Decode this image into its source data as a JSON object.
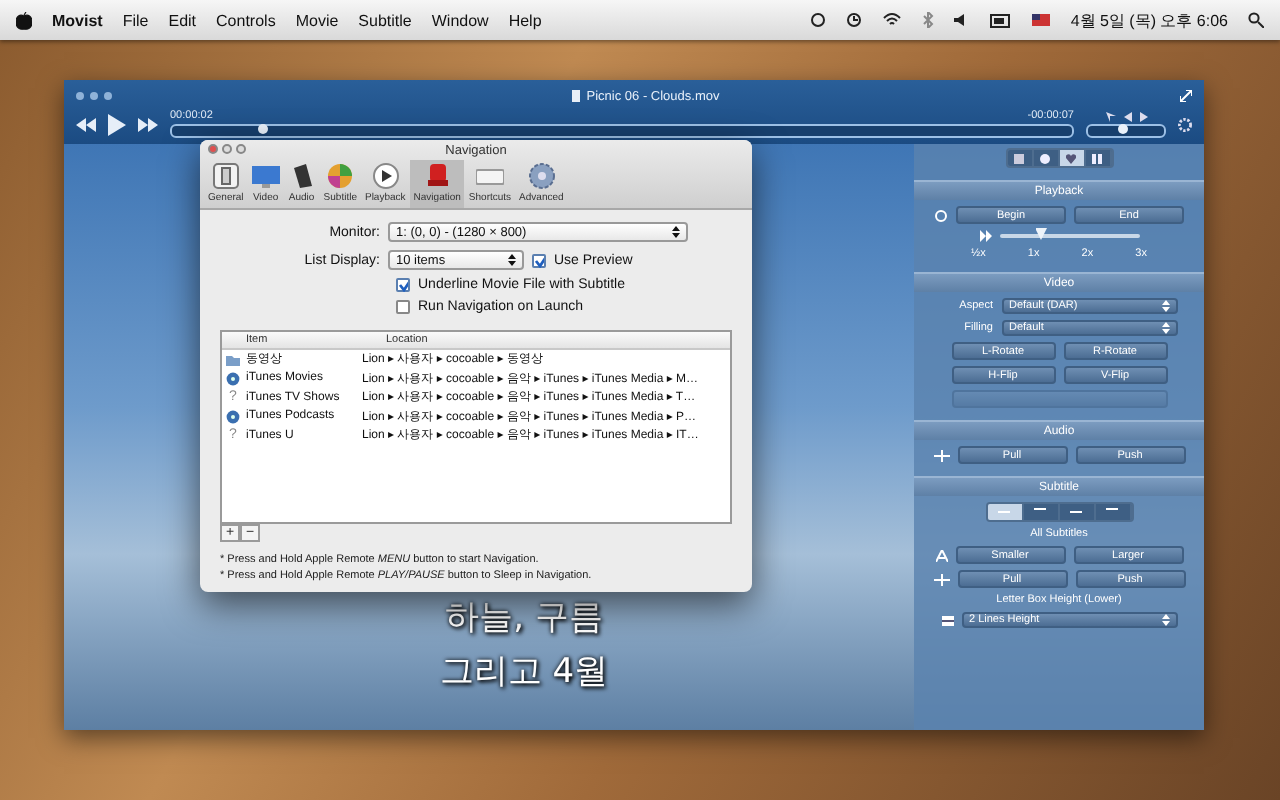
{
  "menu_bar": {
    "app": "Movist",
    "menus": [
      "File",
      "Edit",
      "Controls",
      "Movie",
      "Subtitle",
      "Window",
      "Help"
    ],
    "clock": "4월 5일 (목) 오후 6:06"
  },
  "player": {
    "title": "Picnic 06 - Clouds.mov",
    "elapsed": "00:00:02",
    "remaining": "-00:00:07",
    "position": {
      "level": 0.1
    },
    "volume": {
      "level": 0.45
    },
    "subtitles": [
      "하늘, 구름",
      "그리고 4월"
    ]
  },
  "dialog": {
    "title": "Navigation",
    "toolbar": [
      {
        "label": "General",
        "kind": "general",
        "selected": false
      },
      {
        "label": "Video",
        "kind": "video",
        "selected": false
      },
      {
        "label": "Audio",
        "kind": "audio",
        "selected": false
      },
      {
        "label": "Subtitle",
        "kind": "subtitle",
        "selected": false
      },
      {
        "label": "Playback",
        "kind": "playback",
        "selected": false
      },
      {
        "label": "Navigation",
        "kind": "navigation",
        "selected": true
      },
      {
        "label": "Shortcuts",
        "kind": "shortcuts",
        "selected": false
      },
      {
        "label": "Advanced",
        "kind": "advanced",
        "selected": false
      }
    ],
    "monitor": {
      "label": "Monitor:",
      "value": "1: (0, 0) - (1280 × 800)"
    },
    "list_display": {
      "label": "List Display:",
      "value": "10 items"
    },
    "options": [
      {
        "label": "Use Preview",
        "checked": true
      },
      {
        "label": "Underline Movie File with Subtitle",
        "checked": true
      },
      {
        "label": "Run Navigation on Launch",
        "checked": false
      }
    ],
    "table": {
      "columns": [
        "Item",
        "Location"
      ],
      "rows": [
        {
          "kind": "folder",
          "item": "동영상",
          "location": "Lion ▸ 사용자 ▸ cocoable ▸ 동영상"
        },
        {
          "kind": "itunes",
          "item": "iTunes Movies",
          "location": "Lion ▸ 사용자 ▸ cocoable ▸ 음악 ▸ iTunes ▸ iTunes Media ▸ M…"
        },
        {
          "kind": "missing",
          "glyph": "?",
          "item": "iTunes TV Shows",
          "location": "Lion ▸ 사용자 ▸ cocoable ▸ 음악 ▸ iTunes ▸ iTunes Media ▸ T…"
        },
        {
          "kind": "itunes",
          "item": "iTunes Podcasts",
          "location": "Lion ▸ 사용자 ▸ cocoable ▸ 음악 ▸ iTunes ▸ iTunes Media ▸ P…"
        },
        {
          "kind": "missing",
          "glyph": "?",
          "item": "iTunes U",
          "location": "Lion ▸ 사용자 ▸ cocoable ▸ 음악 ▸ iTunes ▸ iTunes Media ▸ IT…"
        }
      ]
    },
    "list_buttons": [
      "+",
      "−"
    ],
    "notes": [
      "* Press and Hold Apple Remote *MENU* button to start Navigation.",
      "* Press and Hold Apple Remote *PLAY/PAUSE* button to Sleep in Navigation."
    ]
  },
  "panel": {
    "tabs": [
      {
        "kind": "list",
        "selected": false
      },
      {
        "kind": "info",
        "selected": false
      },
      {
        "kind": "heart",
        "selected": true
      },
      {
        "kind": "columns",
        "selected": false
      }
    ],
    "playback": {
      "title": "Playback",
      "buttons": [
        "Begin",
        "End"
      ],
      "speed": {
        "level": 0.3
      },
      "speed_labels": [
        "½x",
        "1x",
        "2x",
        "3x"
      ]
    },
    "video": {
      "title": "Video",
      "aspect": {
        "label": "Aspect",
        "value": "Default (DAR)"
      },
      "filling": {
        "label": "Filling",
        "value": "Default"
      },
      "rotate": [
        "L-Rotate",
        "R-Rotate"
      ],
      "flip": [
        "H-Flip",
        "V-Flip"
      ],
      "extra_button": {
        "disabled": true
      }
    },
    "audio": {
      "title": "Audio",
      "buttons": [
        "Pull",
        "Push"
      ]
    },
    "subtitle": {
      "title": "Subtitle",
      "positions": [
        {
          "selected": true
        },
        {
          "selected": false
        },
        {
          "selected": false
        },
        {
          "selected": false
        }
      ],
      "target": "All Subtitles",
      "size": [
        "Smaller",
        "Larger"
      ],
      "sync": [
        "Pull",
        "Push"
      ],
      "letterbox_label": "Letter Box Height (Lower)",
      "letterbox": "2 Lines Height"
    }
  }
}
